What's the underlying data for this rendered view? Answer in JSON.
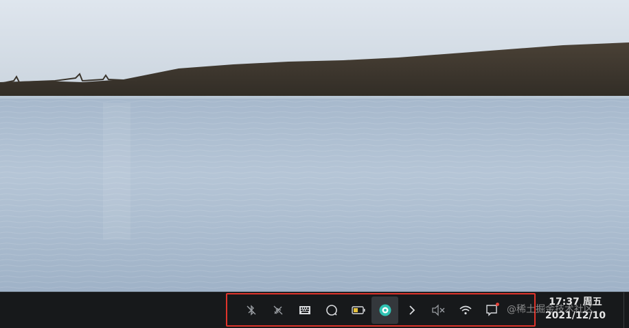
{
  "wallpaper": {
    "description_icon": "lake-landscape-wallpaper"
  },
  "taskbar": {
    "highlight_color": "#e0342b",
    "tray_icons": [
      {
        "name": "bluetooth-off-icon"
      },
      {
        "name": "airplane-mode-icon"
      },
      {
        "name": "keyboard-layout-icon"
      },
      {
        "name": "search-icon"
      },
      {
        "name": "battery-icon"
      },
      {
        "name": "app-indicator-icon"
      },
      {
        "name": "chevron-right-icon"
      },
      {
        "name": "volume-muted-icon"
      },
      {
        "name": "wifi-icon"
      },
      {
        "name": "notification-icon"
      }
    ],
    "clock": {
      "time": "17:37 周五",
      "date": "2021/12/10"
    },
    "watermark": "@稀土掘金技术社区"
  }
}
